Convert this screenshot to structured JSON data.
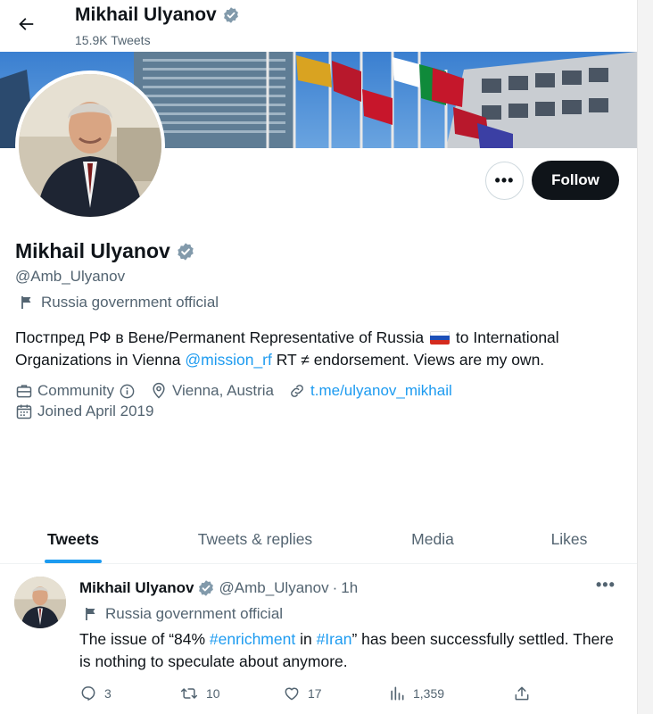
{
  "header": {
    "name": "Mikhail Ulyanov",
    "tweet_count": "15.9K Tweets"
  },
  "profile": {
    "name": "Mikhail Ulyanov",
    "handle": "@Amb_Ulyanov",
    "affiliation": "Russia government official",
    "bio_part1": "Постпред РФ в Вене/Permanent Representative of Russia",
    "bio_part2": " to International Organizations in Vienna ",
    "bio_link": "@mission_rf",
    "bio_part3": " RT ≠ endorsement. Views are my own.",
    "category": "Community",
    "location": "Vienna, Austria",
    "website": "t.me/ulyanov_mikhail",
    "joined": "Joined April 2019",
    "follow_label": "Follow",
    "more_label": "•••"
  },
  "tabs": [
    {
      "label": "Tweets",
      "active": true
    },
    {
      "label": "Tweets & replies",
      "active": false
    },
    {
      "label": "Media",
      "active": false
    },
    {
      "label": "Likes",
      "active": false
    }
  ],
  "tweet": {
    "name": "Mikhail Ulyanov",
    "handle": "@Amb_Ulyanov",
    "sep": "·",
    "time": "1h",
    "affiliation": "Russia government official",
    "text_a": "The issue of “84% ",
    "hashtag1": "#enrichment",
    "text_b": " in ",
    "hashtag2": "#Iran",
    "text_c": "” has been successfully settled. There is nothing to speculate about anymore.",
    "replies": "3",
    "retweets": "10",
    "likes": "17",
    "views": "1,359",
    "more_label": "•••"
  },
  "colors": {
    "accent": "#1d9bf0",
    "verified_badge": "#829aab",
    "follow_button": "#0f1419",
    "secondary_text": "#536471"
  },
  "icons": [
    "back-arrow-icon",
    "verified-badge-icon",
    "flag-icon",
    "briefcase-icon",
    "info-icon",
    "location-pin-icon",
    "link-icon",
    "calendar-icon",
    "reply-icon",
    "retweet-icon",
    "like-icon",
    "views-icon",
    "share-icon",
    "more-icon"
  ]
}
